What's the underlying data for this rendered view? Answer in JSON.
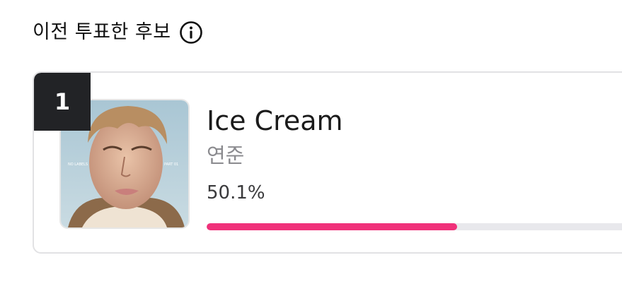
{
  "header": {
    "title": "이전 투표한 후보",
    "info_icon": "info-circle-icon"
  },
  "candidate": {
    "rank": "1",
    "title": "Ice Cream",
    "artist": "연준",
    "percent_text": "50.1%",
    "progress": 0.501,
    "cover": {
      "left_text": "NO LABELS",
      "right_text": "PART 01"
    }
  },
  "colors": {
    "accent": "#f0317a",
    "track": "#e8e8ec",
    "badge": "#222326",
    "border": "#e2e2e4"
  }
}
